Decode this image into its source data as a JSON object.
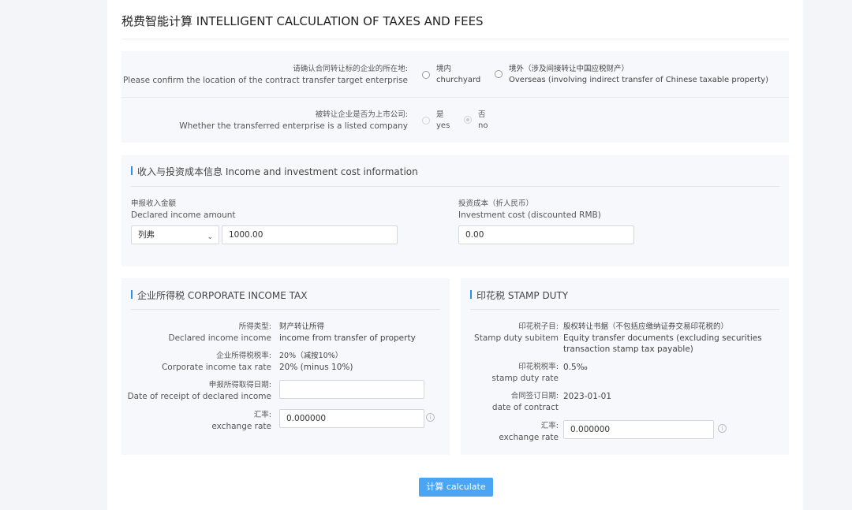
{
  "page": {
    "title": "税费智能计算 INTELLIGENT CALCULATION OF TAXES AND FEES"
  },
  "location_question": {
    "label_cn": "请确认合同转让标的企业的所在地:",
    "label_en": "Please confirm the location of the contract transfer target enterprise",
    "options": [
      {
        "cn": "境内",
        "en": "churchyard"
      },
      {
        "cn": "境外（涉及间接转让中国应税财产）",
        "en": "Overseas (involving indirect transfer of Chinese taxable property)"
      }
    ]
  },
  "listed_question": {
    "label_cn": "被转让企业是否为上市公司:",
    "label_en": "Whether the transferred enterprise is a listed company",
    "options": [
      {
        "cn": "是",
        "en": "yes"
      },
      {
        "cn": "否",
        "en": "no"
      }
    ],
    "selected": "no"
  },
  "income_section": {
    "title": "收入与投资成本信息 Income and investment cost information",
    "declared_income": {
      "label_cn": "申报收入金额",
      "label_en": "Declared income amount",
      "currency": "列弗",
      "value": "1000.00"
    },
    "investment_cost": {
      "label_cn": "投资成本（折人民币）",
      "label_en": "Investment cost (discounted RMB)",
      "value": "0.00"
    }
  },
  "cit_section": {
    "title": "企业所得税 CORPORATE INCOME TAX",
    "income_type": {
      "label_cn": "所得类型:",
      "label_en": "Declared income income",
      "value_cn": "财产转让所得",
      "value_en": "income from transfer of property"
    },
    "tax_rate": {
      "label_cn": "企业所得税税率:",
      "label_en": "Corporate income tax rate",
      "value_cn": "20%（减按10%）",
      "value_en": "20% (minus 10%)"
    },
    "receipt_date": {
      "label_cn": "申报所得取得日期:",
      "label_en": "Date of receipt of declared income",
      "value": ""
    },
    "exchange_rate": {
      "label_cn": "汇率:",
      "label_en": "exchange rate",
      "value": "0.000000"
    }
  },
  "stamp_section": {
    "title": "印花税 STAMP DUTY",
    "subitem": {
      "label_cn": "印花税子目:",
      "label_en": "Stamp duty subitem",
      "value_cn": "股权转让书据（不包括应缴纳证券交易印花税的）",
      "value_en_1": "Equity transfer documents (excluding securities",
      "value_en_2": "transaction stamp tax payable)"
    },
    "rate": {
      "label_cn": "印花税税率:",
      "label_en": "stamp duty rate",
      "value": "0.5‰"
    },
    "contract_date": {
      "label_cn": "合同签订日期:",
      "label_en": "date of contract",
      "value": "2023-01-01"
    },
    "exchange_rate": {
      "label_cn": "汇率:",
      "label_en": "exchange rate",
      "value": "0.000000"
    }
  },
  "actions": {
    "calculate": "计算 calculate"
  },
  "icons": {
    "info": "i"
  },
  "colors": {
    "accent": "#2d8cf0",
    "button": "#4aa6f5"
  }
}
